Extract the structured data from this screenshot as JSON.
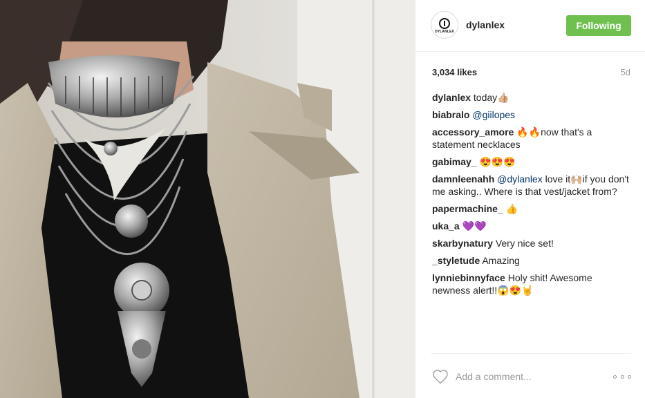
{
  "post": {
    "author": "dylanlex",
    "avatar_text": "DYLANLEX",
    "follow_label": "Following",
    "likes": "3,034 likes",
    "age": "5d"
  },
  "comments": [
    {
      "user": "dylanlex",
      "text": " today👍🏼"
    },
    {
      "user": "biabralo",
      "mention": "@giilopes",
      "text": ""
    },
    {
      "user": "accessory_amore",
      "text": " 🔥🔥now that's a statement necklaces"
    },
    {
      "user": "gabimay_",
      "text": " 😍😍😍"
    },
    {
      "user": "damnleenahh",
      "mention": "@dylanlex",
      "text": " love it🙌🏼if you don't me asking.. Where is that vest/jacket from?"
    },
    {
      "user": "papermachine_",
      "text": " 👍"
    },
    {
      "user": "uka_a",
      "text": " 💜💜"
    },
    {
      "user": "skarbynatury",
      "text": " Very nice set!"
    },
    {
      "user": "_styletude",
      "text": " Amazing"
    },
    {
      "user": "lynniebinnyface",
      "text": " Holy shit! Awesome newness alert!!😱😍🤘"
    }
  ],
  "footer": {
    "comment_placeholder": "Add a comment...",
    "heart_icon": "heart-outline-icon",
    "more_icon": "more-options-icon"
  },
  "colors": {
    "follow_button": "#70c050",
    "mention": "#003569",
    "muted": "#999999"
  }
}
